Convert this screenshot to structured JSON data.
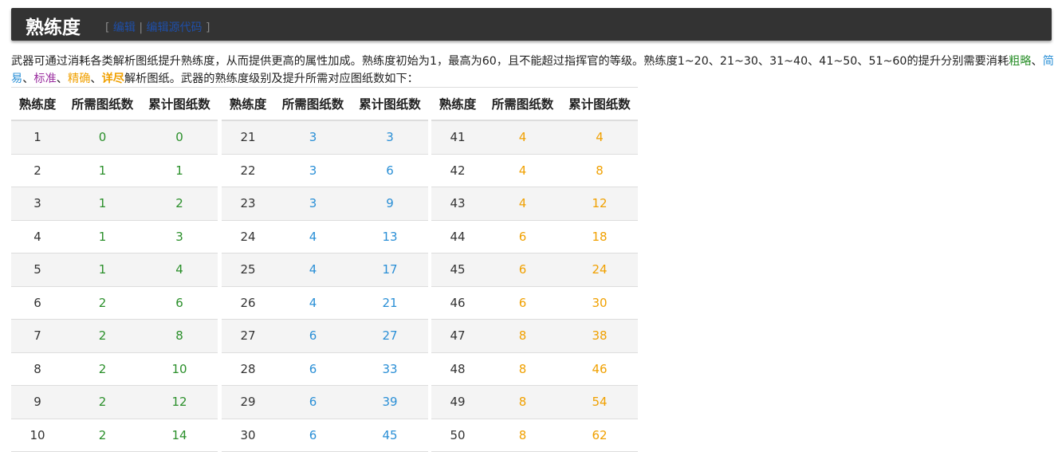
{
  "header": {
    "title": "熟练度",
    "edit_open": "[",
    "edit_link": "编辑",
    "edit_sep": "|",
    "edit_source_link": "编辑源代码",
    "edit_close": "]"
  },
  "intro": {
    "p1": "武器可通过消耗各类解析图纸提升熟练度，从而提供更高的属性加成。熟练度初始为1，最高为60，且不能超过指挥官的等级。熟练度1~20、21~30、31~40、41~50、51~60的提升分别需要消耗",
    "t1": "粗略",
    "s1": "、",
    "t2": "简易",
    "s2": "、",
    "t3": "标准",
    "s3": "、",
    "t4": "精确",
    "s4": "、",
    "t5": "详尽",
    "p2": "解析图纸。武器的熟练度级别及提升所需对应图纸数如下："
  },
  "columns": [
    "熟练度",
    "所需图纸数",
    "累计图纸数"
  ],
  "colors": {
    "green": "#2a8f2a",
    "blue": "#2a8fd6",
    "purple": "#9b2fa0",
    "orange": "#f0a000"
  },
  "tables": [
    {
      "rows": [
        {
          "level": "1",
          "need": "0",
          "total": "0",
          "color": "#2a8f2a"
        },
        {
          "level": "2",
          "need": "1",
          "total": "1",
          "color": "#2a8f2a"
        },
        {
          "level": "3",
          "need": "1",
          "total": "2",
          "color": "#2a8f2a"
        },
        {
          "level": "4",
          "need": "1",
          "total": "3",
          "color": "#2a8f2a"
        },
        {
          "level": "5",
          "need": "1",
          "total": "4",
          "color": "#2a8f2a"
        },
        {
          "level": "6",
          "need": "2",
          "total": "6",
          "color": "#2a8f2a"
        },
        {
          "level": "7",
          "need": "2",
          "total": "8",
          "color": "#2a8f2a"
        },
        {
          "level": "8",
          "need": "2",
          "total": "10",
          "color": "#2a8f2a"
        },
        {
          "level": "9",
          "need": "2",
          "total": "12",
          "color": "#2a8f2a"
        },
        {
          "level": "10",
          "need": "2",
          "total": "14",
          "color": "#2a8f2a"
        }
      ]
    },
    {
      "rows": [
        {
          "level": "21",
          "need": "3",
          "total": "3",
          "color": "#2a8fd6"
        },
        {
          "level": "22",
          "need": "3",
          "total": "6",
          "color": "#2a8fd6"
        },
        {
          "level": "23",
          "need": "3",
          "total": "9",
          "color": "#2a8fd6"
        },
        {
          "level": "24",
          "need": "4",
          "total": "13",
          "color": "#2a8fd6"
        },
        {
          "level": "25",
          "need": "4",
          "total": "17",
          "color": "#2a8fd6"
        },
        {
          "level": "26",
          "need": "4",
          "total": "21",
          "color": "#2a8fd6"
        },
        {
          "level": "27",
          "need": "6",
          "total": "27",
          "color": "#2a8fd6"
        },
        {
          "level": "28",
          "need": "6",
          "total": "33",
          "color": "#2a8fd6"
        },
        {
          "level": "29",
          "need": "6",
          "total": "39",
          "color": "#2a8fd6"
        },
        {
          "level": "30",
          "need": "6",
          "total": "45",
          "color": "#2a8fd6"
        }
      ]
    },
    {
      "rows": [
        {
          "level": "41",
          "need": "4",
          "total": "4",
          "color": "#f0a000"
        },
        {
          "level": "42",
          "need": "4",
          "total": "8",
          "color": "#f0a000"
        },
        {
          "level": "43",
          "need": "4",
          "total": "12",
          "color": "#f0a000"
        },
        {
          "level": "44",
          "need": "6",
          "total": "18",
          "color": "#f0a000"
        },
        {
          "level": "45",
          "need": "6",
          "total": "24",
          "color": "#f0a000"
        },
        {
          "level": "46",
          "need": "6",
          "total": "30",
          "color": "#f0a000"
        },
        {
          "level": "47",
          "need": "8",
          "total": "38",
          "color": "#f0a000"
        },
        {
          "level": "48",
          "need": "8",
          "total": "46",
          "color": "#f0a000"
        },
        {
          "level": "49",
          "need": "8",
          "total": "54",
          "color": "#f0a000"
        },
        {
          "level": "50",
          "need": "8",
          "total": "62",
          "color": "#f0a000"
        }
      ]
    }
  ]
}
